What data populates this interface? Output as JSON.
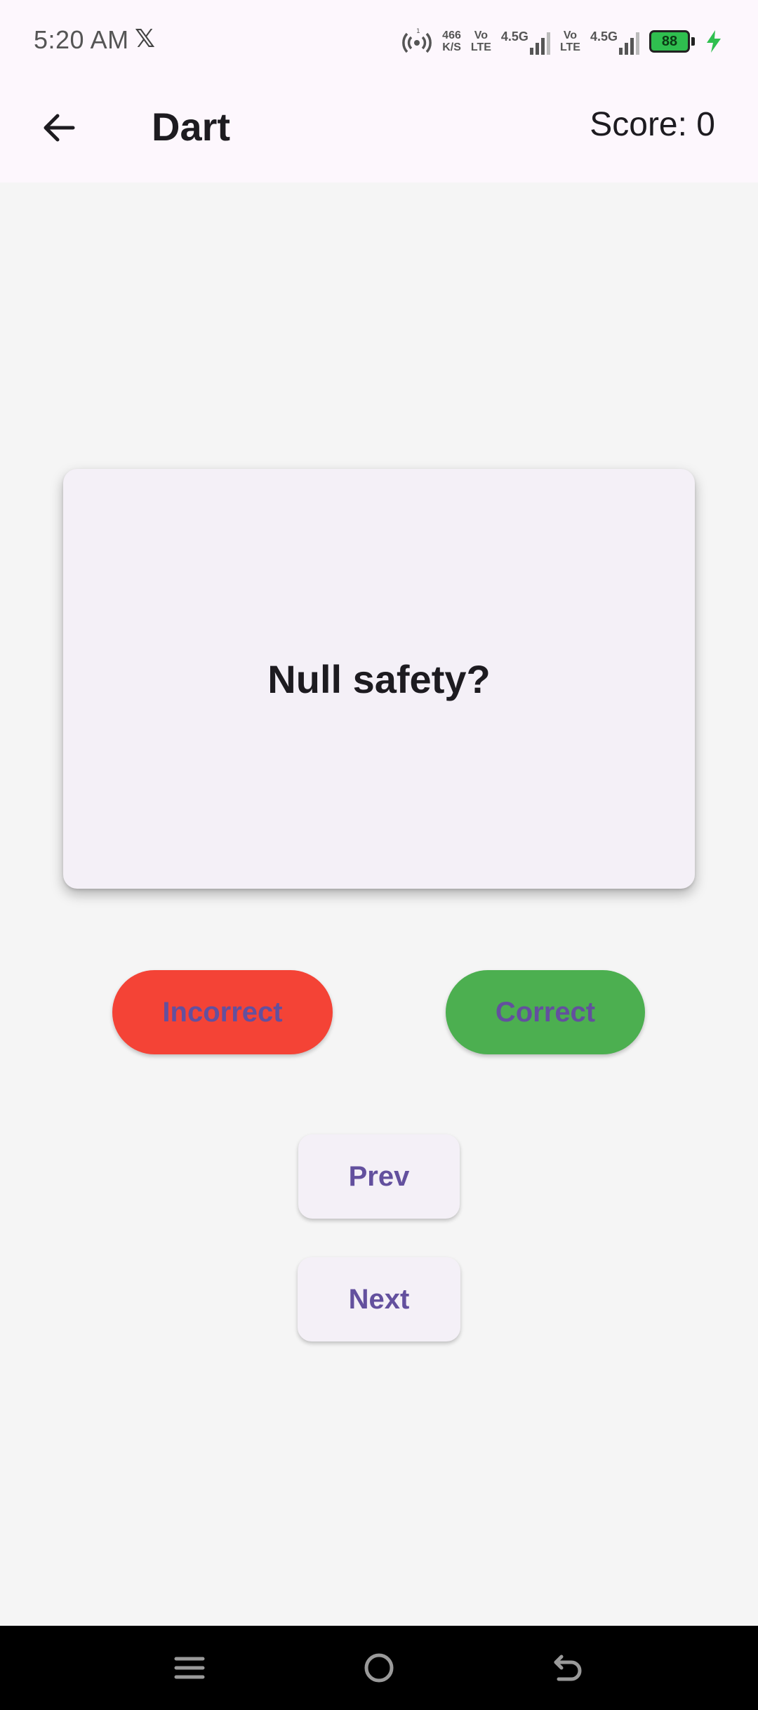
{
  "status_bar": {
    "time": "5:20 AM",
    "x_logo": "𝕏",
    "net_speed_value": "466",
    "net_speed_unit": "K/S",
    "sim1_volte_top": "Vo",
    "sim1_volte_bottom": "LTE",
    "sim1_network": "4.5G",
    "sim2_volte_top": "Vo",
    "sim2_volte_bottom": "LTE",
    "sim2_network": "4.5G",
    "battery_level": "88",
    "battery_color": "#2fbf4f",
    "icons": [
      "hotspot-icon",
      "signal-icon",
      "battery-icon",
      "charging-icon"
    ]
  },
  "app_bar": {
    "title": "Dart",
    "score_label": "Score: 0",
    "back_icon": "arrow-left-icon"
  },
  "card": {
    "question": "Null safety?"
  },
  "answer_buttons": {
    "incorrect_label": "Incorrect",
    "correct_label": "Correct",
    "incorrect_color": "#f44336",
    "correct_color": "#4caf50",
    "label_color": "#63509e"
  },
  "navigation": {
    "prev_label": "Prev",
    "next_label": "Next"
  },
  "system_nav": {
    "icons": [
      "menu-icon",
      "home-icon",
      "back-icon"
    ]
  }
}
